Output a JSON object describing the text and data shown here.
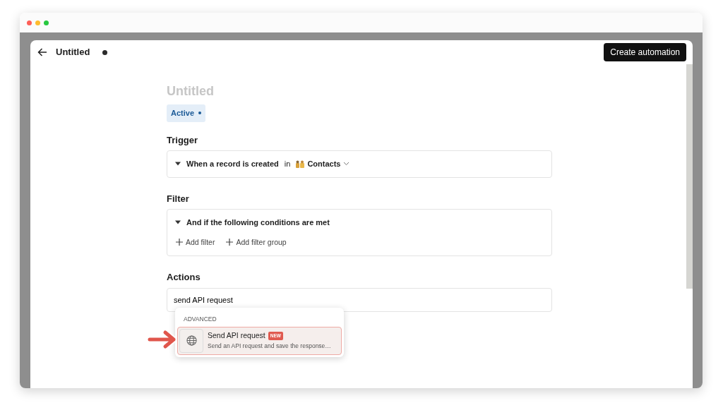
{
  "header": {
    "title": "Untitled",
    "unsaved": true,
    "button": "Create automation"
  },
  "automation": {
    "name_placeholder": "Untitled",
    "status": {
      "label": "Active",
      "on": true
    }
  },
  "trigger": {
    "heading": "Trigger",
    "event": "When a record is created",
    "connector": "in",
    "object": "Contacts",
    "expanded": true
  },
  "filter": {
    "heading": "Filter",
    "condition": "And if the following conditions are met",
    "expanded": true,
    "buttons": [
      "Add filter",
      "Add filter group"
    ]
  },
  "actions": {
    "heading": "Actions",
    "search_value": "send API request",
    "dropdown": {
      "section": "ADVANCED",
      "items": [
        {
          "title": "Send API request",
          "badge": "NEW",
          "description": "Send an API request and save the response…",
          "selected": true
        }
      ]
    }
  }
}
